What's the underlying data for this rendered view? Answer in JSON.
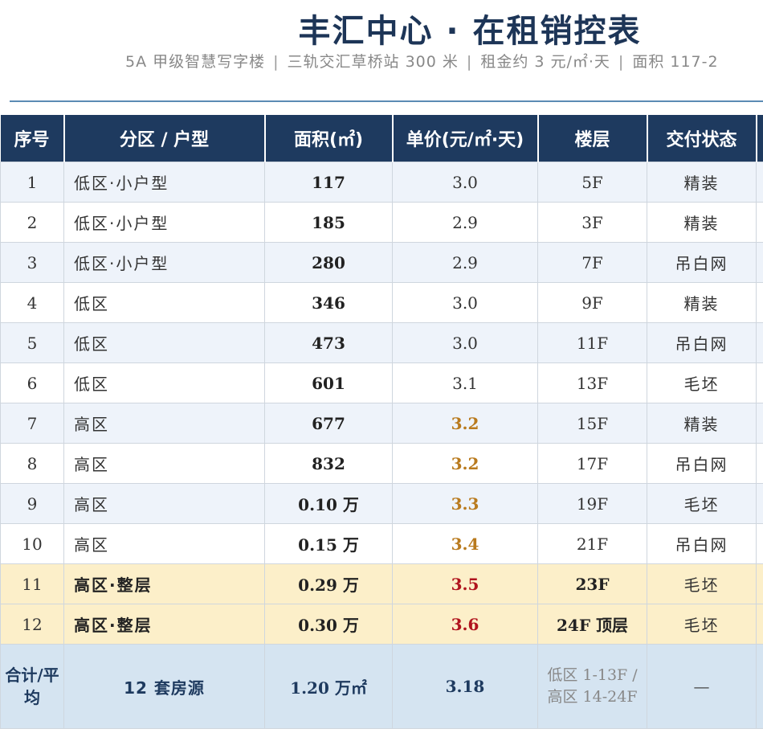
{
  "header": {
    "title": "丰汇中心 · 在租销控表",
    "subtitle_items": [
      "5A 甲级智慧写字楼",
      "三轨交汇草桥站 300 米",
      "租金约 3 元/㎡·天",
      "面积 117-2"
    ],
    "separator": "|"
  },
  "table": {
    "columns": [
      "序号",
      "分区 / 户型",
      "面积(㎡)",
      "单价(元/㎡·天)",
      "楼层",
      "交付状态",
      ""
    ],
    "rows": [
      {
        "no": "1",
        "zone": "低区·小户型",
        "area": "117",
        "price": "3.0",
        "floor": "5F",
        "status": "精装"
      },
      {
        "no": "2",
        "zone": "低区·小户型",
        "area": "185",
        "price": "2.9",
        "floor": "3F",
        "status": "精装"
      },
      {
        "no": "3",
        "zone": "低区·小户型",
        "area": "280",
        "price": "2.9",
        "floor": "7F",
        "status": "吊白网"
      },
      {
        "no": "4",
        "zone": "低区",
        "area": "346",
        "price": "3.0",
        "floor": "9F",
        "status": "精装"
      },
      {
        "no": "5",
        "zone": "低区",
        "area": "473",
        "price": "3.0",
        "floor": "11F",
        "status": "吊白网"
      },
      {
        "no": "6",
        "zone": "低区",
        "area": "601",
        "price": "3.1",
        "floor": "13F",
        "status": "毛坯"
      },
      {
        "no": "7",
        "zone": "高区",
        "area": "677",
        "price": "3.2",
        "floor": "15F",
        "status": "精装"
      },
      {
        "no": "8",
        "zone": "高区",
        "area": "832",
        "price": "3.2",
        "floor": "17F",
        "status": "吊白网"
      },
      {
        "no": "9",
        "zone": "高区",
        "area": "0.10 万",
        "price": "3.3",
        "floor": "19F",
        "status": "毛坯"
      },
      {
        "no": "10",
        "zone": "高区",
        "area": "0.15 万",
        "price": "3.4",
        "floor": "21F",
        "status": "吊白网"
      },
      {
        "no": "11",
        "zone": "高区·整层",
        "area": "0.29 万",
        "price": "3.5",
        "floor": "23F",
        "status": "毛坯"
      },
      {
        "no": "12",
        "zone": "高区·整层",
        "area": "0.30 万",
        "price": "3.6",
        "floor": "24F 顶层",
        "status": "毛坯"
      }
    ],
    "total": {
      "label": "合计/平均",
      "units": "12 套房源",
      "area": "1.20 万㎡",
      "price": "3.18",
      "floor": "低区 1-13F / 高区 14-24F",
      "status": "—"
    }
  },
  "colors": {
    "header_bg": "#1e3a5f",
    "title": "#1d3557",
    "price_mid": "#b97a1d",
    "price_high": "#b0141e",
    "highlight_row": "#fcefc9",
    "total_row": "#d5e4f1"
  }
}
